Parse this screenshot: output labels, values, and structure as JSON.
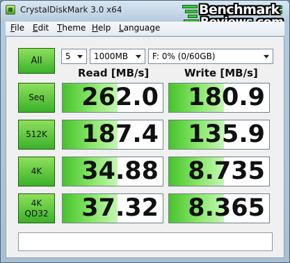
{
  "window": {
    "title": "CrystalDiskMark 3.0 x64"
  },
  "logo": {
    "line1": "Benchmark",
    "line2": "Reviews.com"
  },
  "menu": [
    {
      "accel": "F",
      "rest": "ile"
    },
    {
      "accel": "E",
      "rest": "dit"
    },
    {
      "accel": "T",
      "rest": "heme"
    },
    {
      "accel": "H",
      "rest": "elp"
    },
    {
      "accel": "L",
      "rest": "anguage"
    }
  ],
  "controls": {
    "all_label": "All",
    "count": "5",
    "size": "1000MB",
    "drive": "F: 0% (0/60GB)"
  },
  "columns": {
    "read": "Read [MB/s]",
    "write": "Write [MB/s]"
  },
  "rows": [
    {
      "label": "Seq",
      "read": "262.0",
      "write": "180.9",
      "read_level": 0.55,
      "write_level": 0.55
    },
    {
      "label": "512K",
      "read": "187.4",
      "write": "135.9",
      "read_level": 0.55,
      "write_level": 0.55
    },
    {
      "label": "4K",
      "read": "34.88",
      "write": "8.735",
      "read_level": 0.55,
      "write_level": 0.55
    },
    {
      "label": "4K\nQD32",
      "read": "37.32",
      "write": "8.365",
      "read_level": 0.55,
      "write_level": 0.55
    }
  ],
  "comment": ""
}
